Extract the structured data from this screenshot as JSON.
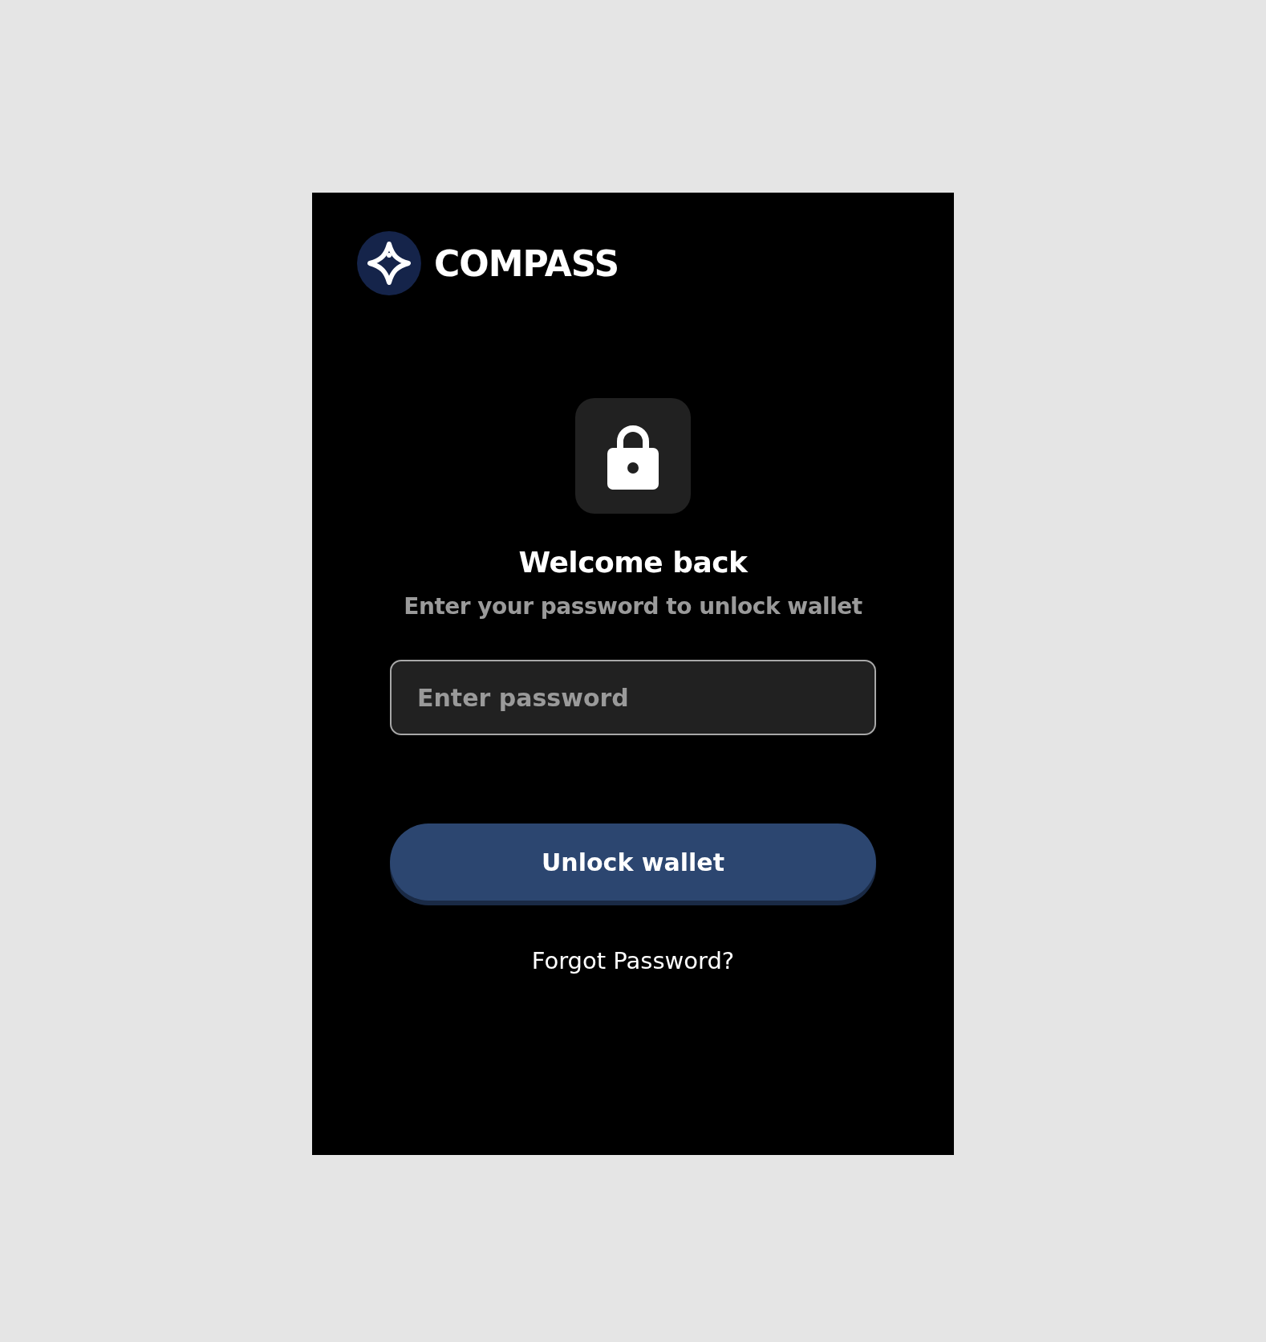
{
  "brand": {
    "name": "COMPASS"
  },
  "heading": "Welcome back",
  "subtitle": "Enter your password to unlock wallet",
  "password_field": {
    "placeholder": "Enter password"
  },
  "unlock_button": {
    "label": "Unlock wallet"
  },
  "forgot_link": {
    "label": "Forgot Password?"
  }
}
